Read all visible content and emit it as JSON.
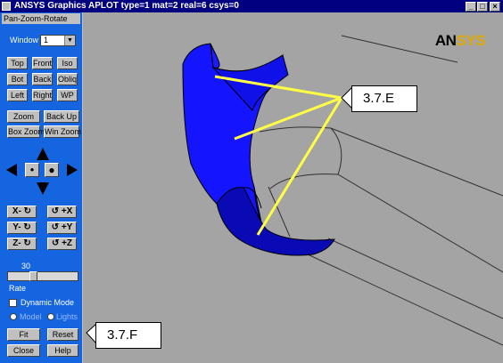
{
  "window": {
    "title": "ANSYS Graphics   APLOT   type=1 mat=2 real=6 csys=0"
  },
  "panel": {
    "title": "Pan-Zoom-Rotate",
    "window_label": "Window",
    "window_value": "1",
    "view_buttons": [
      "Top",
      "Front",
      "Iso",
      "Bot",
      "Back",
      "Obliq",
      "Left",
      "Right",
      "WP"
    ],
    "zoom": "Zoom",
    "back_up": "Back Up",
    "box_zoom": "Box Zoom",
    "win_zoom": "Win Zoom",
    "rotate": [
      "X- ↻",
      "↺ +X",
      "Y- ↻",
      "↺ +Y",
      "Z- ↻",
      "↺ +Z"
    ],
    "rate_value": "30",
    "rate_label": "Rate",
    "dynamic_mode": "Dynamic Mode",
    "model": "Model",
    "lights": "Lights",
    "fit": "Fit",
    "reset": "Reset",
    "close": "Close",
    "help": "Help"
  },
  "logo": {
    "an": "AN",
    "sys": "SYS"
  },
  "callouts": {
    "e": "3.7.E",
    "f": "3.7.F"
  },
  "colors": {
    "panel": "#1565e0",
    "model": "#1414ff",
    "leader": "#ffff44",
    "logo_accent": "#e0a800"
  }
}
